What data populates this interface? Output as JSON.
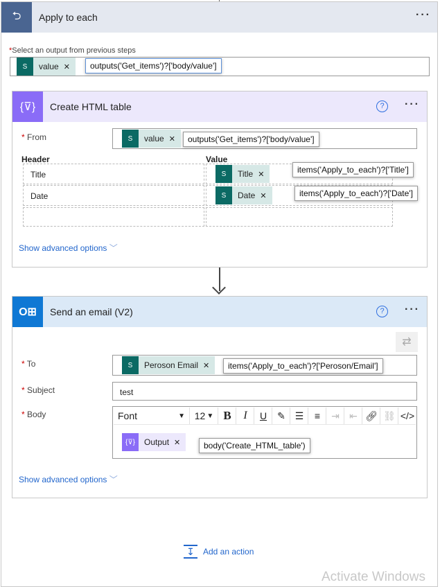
{
  "apply": {
    "title": "Apply to each",
    "select_label": "Select an output from previous steps",
    "token": "value",
    "expression": "outputs('Get_items')?['body/value']"
  },
  "html_table": {
    "title": "Create HTML table",
    "from_label": "From",
    "from_token": "value",
    "from_expression": "outputs('Get_items')?['body/value']",
    "header_col": "Header",
    "value_col": "Value",
    "rows": [
      {
        "header": "Title",
        "token": "Title",
        "expression": "items('Apply_to_each')?['Title']"
      },
      {
        "header": "Date",
        "token": "Date",
        "expression": "items('Apply_to_each')?['Date']"
      }
    ],
    "advanced": "Show advanced options"
  },
  "email": {
    "title": "Send an email (V2)",
    "to_label": "To",
    "to_token": "Peroson Email",
    "to_expression": "items('Apply_to_each')?['Peroson/Email']",
    "subject_label": "Subject",
    "subject_value": "test",
    "body_label": "Body",
    "font": "Font",
    "font_size": "12",
    "body_token": "Output",
    "body_expression": "body('Create_HTML_table')",
    "advanced": "Show advanced options"
  },
  "add_action": "Add an action",
  "watermark": "Activate Windows",
  "colors": {
    "loop": "#4a6591",
    "html_table": "#8a6cf7",
    "outlook": "#0f78d4",
    "sharepoint": "#0b6a64",
    "link": "#2266cc"
  }
}
